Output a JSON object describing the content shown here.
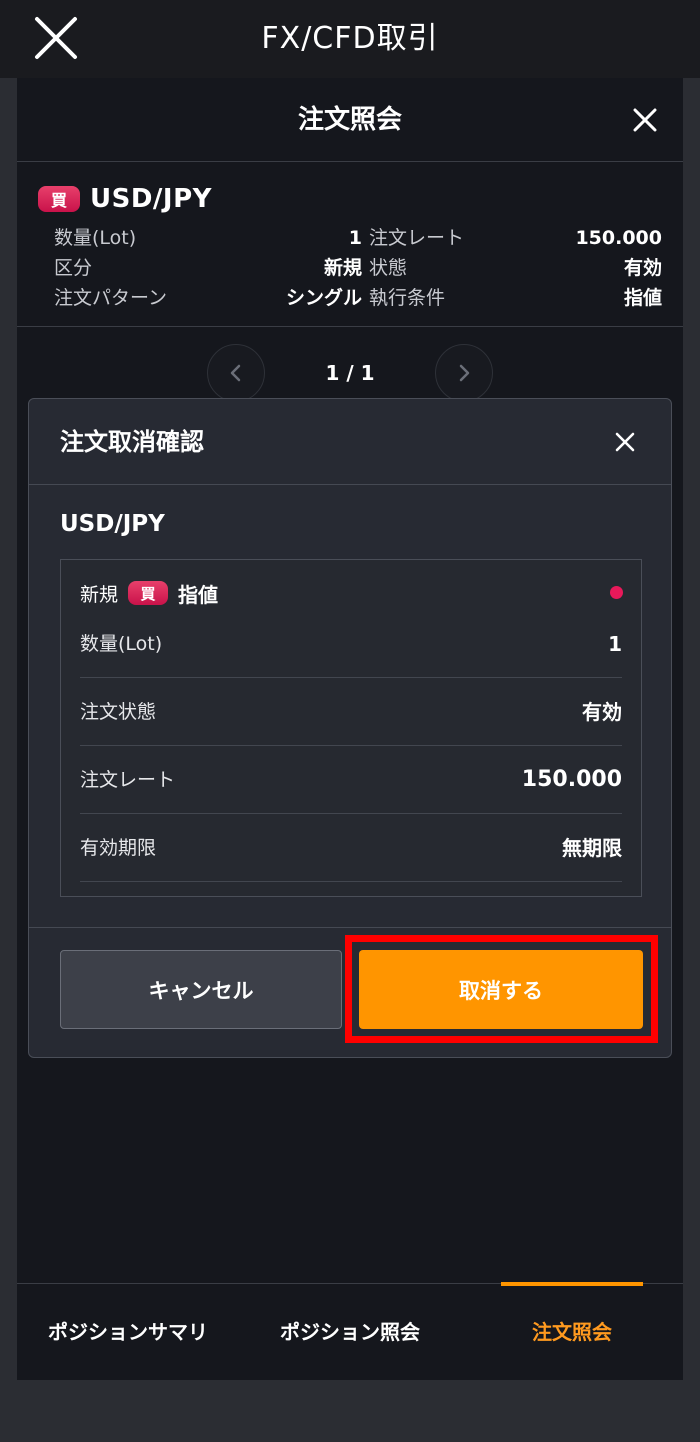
{
  "app": {
    "title": "FX/CFD取引"
  },
  "panel": {
    "title": "注文照会"
  },
  "order": {
    "side_badge": "買",
    "pair": "USD/JPY",
    "rows": [
      {
        "l1": "数量(Lot)",
        "v1": "1",
        "l2": "注文レート",
        "v2": "150.000"
      },
      {
        "l1": "区分",
        "v1": "新規",
        "l2": "状態",
        "v2": "有効"
      },
      {
        "l1": "注文パターン",
        "v1": "シングル",
        "l2": "執行条件",
        "v2": "指値"
      }
    ]
  },
  "pager": {
    "text": "1 / 1"
  },
  "dialog": {
    "title": "注文取消確認",
    "pair": "USD/JPY",
    "category": "新規",
    "side_badge": "買",
    "order_type": "指値",
    "status_dot_color": "#e8195a",
    "rows": [
      {
        "label": "数量(Lot)",
        "value": "1"
      },
      {
        "label": "注文状態",
        "value": "有効"
      },
      {
        "label": "注文レート",
        "value": "150.000"
      },
      {
        "label": "有効期限",
        "value": "無期限"
      }
    ],
    "cancel_label": "キャンセル",
    "confirm_label": "取消する"
  },
  "tabs": [
    {
      "label": "ポジションサマリ",
      "active": false
    },
    {
      "label": "ポジション照会",
      "active": false
    },
    {
      "label": "注文照会",
      "active": true
    }
  ],
  "colors": {
    "accent": "#ff9500",
    "buy": "#d81a55",
    "highlight": "#ff0000"
  }
}
